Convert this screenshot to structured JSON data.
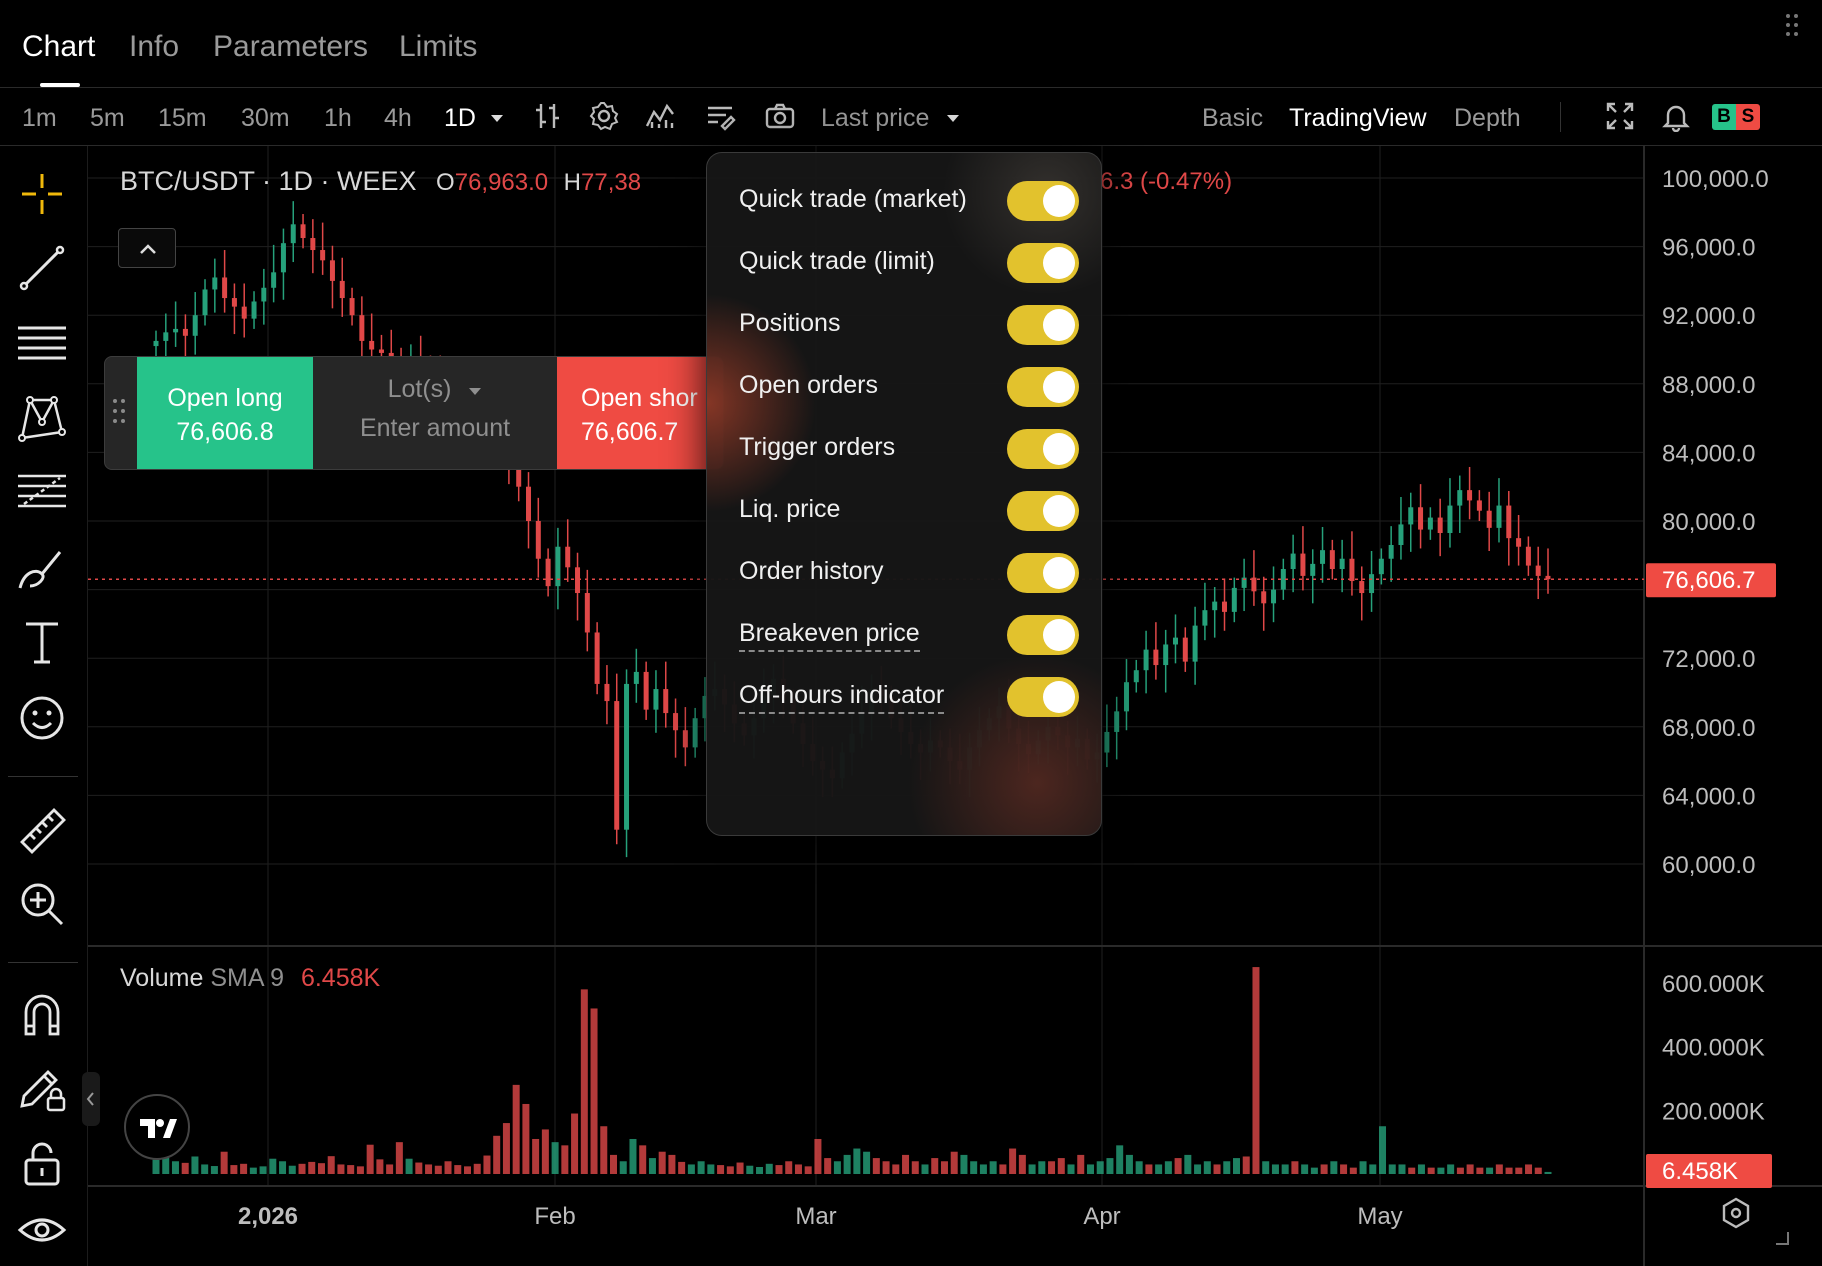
{
  "tabs": [
    {
      "label": "Chart",
      "active": true
    },
    {
      "label": "Info",
      "active": false
    },
    {
      "label": "Parameters",
      "active": false
    },
    {
      "label": "Limits",
      "active": false
    }
  ],
  "toolbar": {
    "timeframes": [
      "1m",
      "5m",
      "15m",
      "30m",
      "1h",
      "4h",
      "1D"
    ],
    "active_timeframe": "1D",
    "price_source": "Last price",
    "views": [
      "Basic",
      "TradingView",
      "Depth"
    ],
    "active_view": "TradingView",
    "bs_badge": {
      "b": "B",
      "s": "S"
    }
  },
  "legend": {
    "symbol": "BTC/USDT · 1D · WEEX",
    "o_label": "O",
    "o_value": "76,963.0",
    "h_label": "H",
    "h_value": "77,38",
    "change": "6.3 (-0.47%)"
  },
  "quick_trade": {
    "long_label": "Open long",
    "long_price": "76,606.8",
    "lots_label": "Lot(s)",
    "amount_placeholder": "Enter amount",
    "short_label": "Open shor",
    "short_price": "76,606.7"
  },
  "settings_popup": {
    "items": [
      {
        "label": "Quick trade (market)",
        "enabled": true,
        "dashed": false
      },
      {
        "label": "Quick trade (limit)",
        "enabled": true,
        "dashed": false
      },
      {
        "label": "Positions",
        "enabled": true,
        "dashed": false
      },
      {
        "label": "Open orders",
        "enabled": true,
        "dashed": false
      },
      {
        "label": "Trigger orders",
        "enabled": true,
        "dashed": false
      },
      {
        "label": "Liq. price",
        "enabled": true,
        "dashed": false
      },
      {
        "label": "Order history",
        "enabled": true,
        "dashed": false
      },
      {
        "label": "Breakeven price",
        "enabled": true,
        "dashed": true
      },
      {
        "label": "Off-hours indicator",
        "enabled": true,
        "dashed": true
      }
    ]
  },
  "volume_legend": {
    "name": "Volume",
    "indicator": "SMA 9",
    "value": "6.458K"
  },
  "colors": {
    "up": "#26a17b",
    "down": "#e04848",
    "toggle": "#e2c22d",
    "long": "#26c38a",
    "short": "#ef4b43",
    "price_tag": "#ef4b43"
  },
  "chart_data": {
    "type": "candlestick",
    "price_axis": {
      "ticks": [
        "100,000.0",
        "96,000.0",
        "92,000.0",
        "88,000.0",
        "84,000.0",
        "80,000.0",
        "72,000.0",
        "68,000.0",
        "64,000.0",
        "60,000.0"
      ],
      "ylim": [
        57000,
        101000
      ],
      "last_price": 76606.7,
      "last_price_label": "76,606.7"
    },
    "volume_axis": {
      "ticks": [
        "600.000K",
        "400.000K",
        "200.000K"
      ],
      "ylim": [
        0,
        650000
      ],
      "last_volume_label": "6.458K"
    },
    "x_axis": {
      "labels": [
        "2,026",
        "Feb",
        "Mar",
        "Apr",
        "May"
      ]
    },
    "closes": [
      90500,
      91000,
      91200,
      90800,
      92000,
      93500,
      94200,
      93000,
      92500,
      91800,
      92800,
      93600,
      94500,
      96200,
      97300,
      96500,
      95800,
      95200,
      94000,
      93000,
      92000,
      90500,
      90000,
      89800,
      89500,
      89000,
      89200,
      88800,
      88300,
      87900,
      87500,
      87200,
      86800,
      86000,
      85200,
      84500,
      83500,
      82000,
      80000,
      77800,
      76200,
      78500,
      77300,
      75800,
      73500,
      70500,
      69500,
      62000,
      70500,
      71200,
      69000,
      70200,
      68800,
      67800,
      66800,
      68500,
      69800,
      70200,
      69300,
      68200,
      67500,
      68500,
      69800,
      70800,
      69600,
      68200,
      67000,
      66000,
      65500,
      65000,
      66500,
      67600,
      68800,
      70200,
      69800,
      68500,
      67700,
      67000,
      66500,
      67200,
      66800,
      66000,
      65500,
      66800,
      67800,
      68500,
      69200,
      67900,
      67000,
      66400,
      67200,
      68000,
      67500,
      66800,
      67300,
      66100,
      66500,
      67700,
      68900,
      70600,
      71300,
      72500,
      71600,
      72800,
      73200,
      71800,
      73900,
      74800,
      75300,
      74700,
      76100,
      76700,
      75900,
      75200,
      76000,
      77200,
      78100,
      76800,
      77500,
      78300,
      77200,
      77800,
      76500,
      75800,
      76900,
      77800,
      78600,
      79800,
      80800,
      79500,
      80200,
      79300,
      80900,
      81800,
      81200,
      80600,
      79600,
      80900,
      79000,
      78500,
      77400,
      76800,
      76606.7
    ],
    "volumes": [
      45000,
      60000,
      40000,
      35000,
      55000,
      30000,
      25000,
      70000,
      28000,
      32000,
      20000,
      24000,
      48000,
      40000,
      26000,
      32000,
      38000,
      34000,
      56000,
      30000,
      28000,
      24000,
      92000,
      46000,
      30000,
      100000,
      48000,
      36000,
      30000,
      26000,
      40000,
      28000,
      24000,
      32000,
      58000,
      120000,
      160000,
      280000,
      220000,
      110000,
      140000,
      100000,
      90000,
      190000,
      580000,
      520000,
      150000,
      60000,
      40000,
      110000,
      90000,
      50000,
      70000,
      60000,
      38000,
      30000,
      40000,
      30000,
      28000,
      24000,
      36000,
      26000,
      22000,
      32000,
      28000,
      40000,
      30000,
      24000,
      110000,
      50000,
      40000,
      60000,
      80000,
      70000,
      50000,
      40000,
      30000,
      60000,
      40000,
      30000,
      50000,
      40000,
      70000,
      60000,
      40000,
      30000,
      40000,
      30000,
      80000,
      60000,
      30000,
      40000,
      40000,
      50000,
      30000,
      60000,
      30000,
      40000,
      50000,
      90000,
      60000,
      40000,
      30000,
      30000,
      40000,
      50000,
      60000,
      30000,
      40000,
      30000,
      40000,
      50000,
      55000,
      650000,
      40000,
      30000,
      30000,
      40000,
      30000,
      20000,
      30000,
      40000,
      30000,
      20000,
      40000,
      30000,
      150000,
      30000,
      30000,
      20000,
      30000,
      20000,
      20000,
      30000,
      20000,
      30000,
      20000,
      20000,
      30000,
      20000,
      20000,
      30000,
      20000,
      6458
    ]
  }
}
